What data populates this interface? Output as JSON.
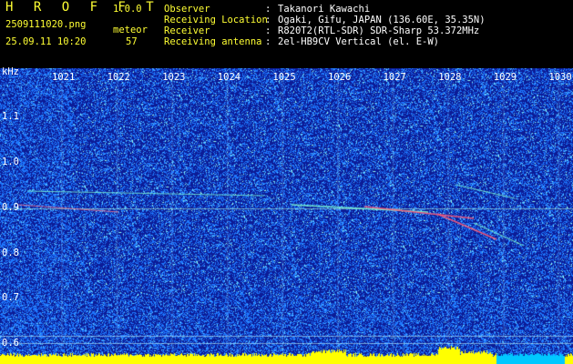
{
  "header": {
    "app_title": "H R O F F T",
    "version": "1.0.0",
    "filename": "2509111020.png",
    "datetime": "25.09.11 10:20",
    "event_type": "meteor",
    "event_count": "57",
    "info": [
      {
        "label": "Observer",
        "sep": ":",
        "value": "Takanori Kawachi"
      },
      {
        "label": "Receiving Location",
        "sep": ":",
        "value": "Ogaki, Gifu, JAPAN (136.60E, 35.35N)"
      },
      {
        "label": "Receiver",
        "sep": ":",
        "value": "R820T2(RTL-SDR) SDR-Sharp 53.372MHz"
      },
      {
        "label": "Receiving antenna",
        "sep": ":",
        "value": "2el-HB9CV Vertical (el. E-W)"
      }
    ]
  },
  "spectrogram": {
    "y_unit": "kHz",
    "y_ticks": [
      "1.1",
      "1.0",
      "0.9",
      "0.8",
      "0.7",
      "0.6"
    ],
    "x_ticks": [
      "1021",
      "1022",
      "1023",
      "1024",
      "1025",
      "1026",
      "1027",
      "1028",
      "1029",
      "1030"
    ],
    "colors": {
      "background": "#0a1a8c",
      "noise": "#2a8cff",
      "signal": "#7fffd4",
      "hot": "#ff4060",
      "baseline": "#ffff00",
      "baseline_alt": "#00c8ff"
    }
  }
}
